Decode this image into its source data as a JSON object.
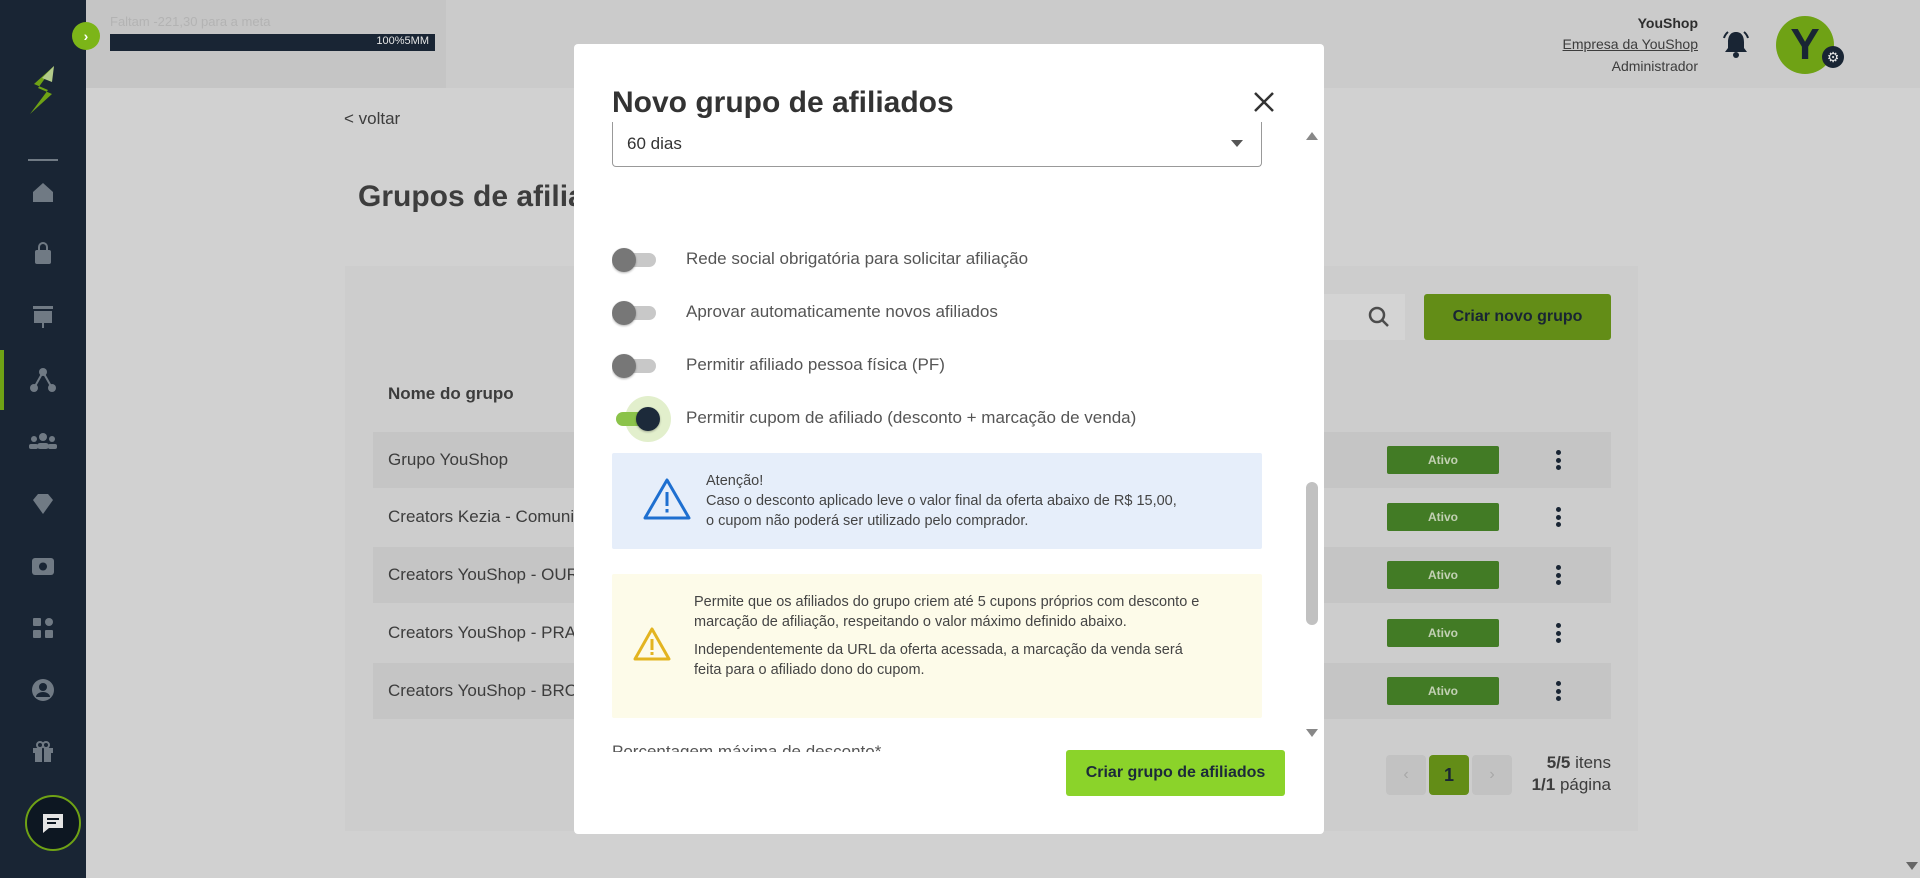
{
  "header": {
    "faltam_text": "Faltam -221,30 para a meta",
    "progress_label": "100%",
    "progress_extra": "5MM",
    "user_name": "YouShop",
    "user_company": "Empresa da YouShop",
    "user_role": "Administrador",
    "avatar_initial": "Y"
  },
  "page": {
    "back_link": "< voltar",
    "title": "Grupos de afiliados",
    "create_button": "Criar novo grupo",
    "column_header": "Nome do grupo",
    "rows": [
      {
        "name": "Grupo YouShop",
        "status": "Ativo"
      },
      {
        "name": "Creators Kezia - Comuni",
        "status": "Ativo"
      },
      {
        "name": "Creators YouShop - OUR",
        "status": "Ativo"
      },
      {
        "name": "Creators YouShop - PRA",
        "status": "Ativo"
      },
      {
        "name": "Creators YouShop - BRO",
        "status": "Ativo"
      }
    ],
    "pager": {
      "current": "1",
      "items_count": "5/5",
      "items_word": " itens",
      "pages_count": "1/1",
      "pages_word": " página"
    }
  },
  "modal": {
    "title": "Novo grupo de afiliados",
    "select_value": "60 dias",
    "toggles": [
      {
        "label": "Rede social obrigatória para solicitar afiliação",
        "on": false
      },
      {
        "label": "Aprovar automaticamente novos afiliados",
        "on": false
      },
      {
        "label": "Permitir afiliado pessoa física (PF)",
        "on": false
      },
      {
        "label": "Permitir cupom de afiliado (desconto + marcação de venda)",
        "on": true
      }
    ],
    "info": {
      "heading": "Atenção!",
      "line1": "Caso o desconto aplicado leve o valor final da oferta abaixo de R$ 15,00,",
      "line2": "o cupom não poderá ser utilizado pelo comprador."
    },
    "warning": {
      "paragraph1": "Permite que os afiliados do grupo criem até 5 cupons próprios com desconto e marcação de afiliação, respeitando o valor máximo definido abaixo.",
      "paragraph2": "Independentemente da URL da oferta acessada, a marcação da venda será feita para o afiliado dono do cupom."
    },
    "field_label": "Porcentagem máxima de desconto*",
    "submit_button": "Criar grupo de afiliados"
  },
  "icons": {
    "sidebar": [
      "home-icon",
      "bag-icon",
      "presentation-icon",
      "affiliates-icon",
      "people-icon",
      "diamond-icon",
      "cash-icon",
      "apps-icon",
      "user-circle-icon",
      "gift-icon"
    ],
    "accent": "#7cb518",
    "sidebar_bg": "#1c2a3a"
  }
}
